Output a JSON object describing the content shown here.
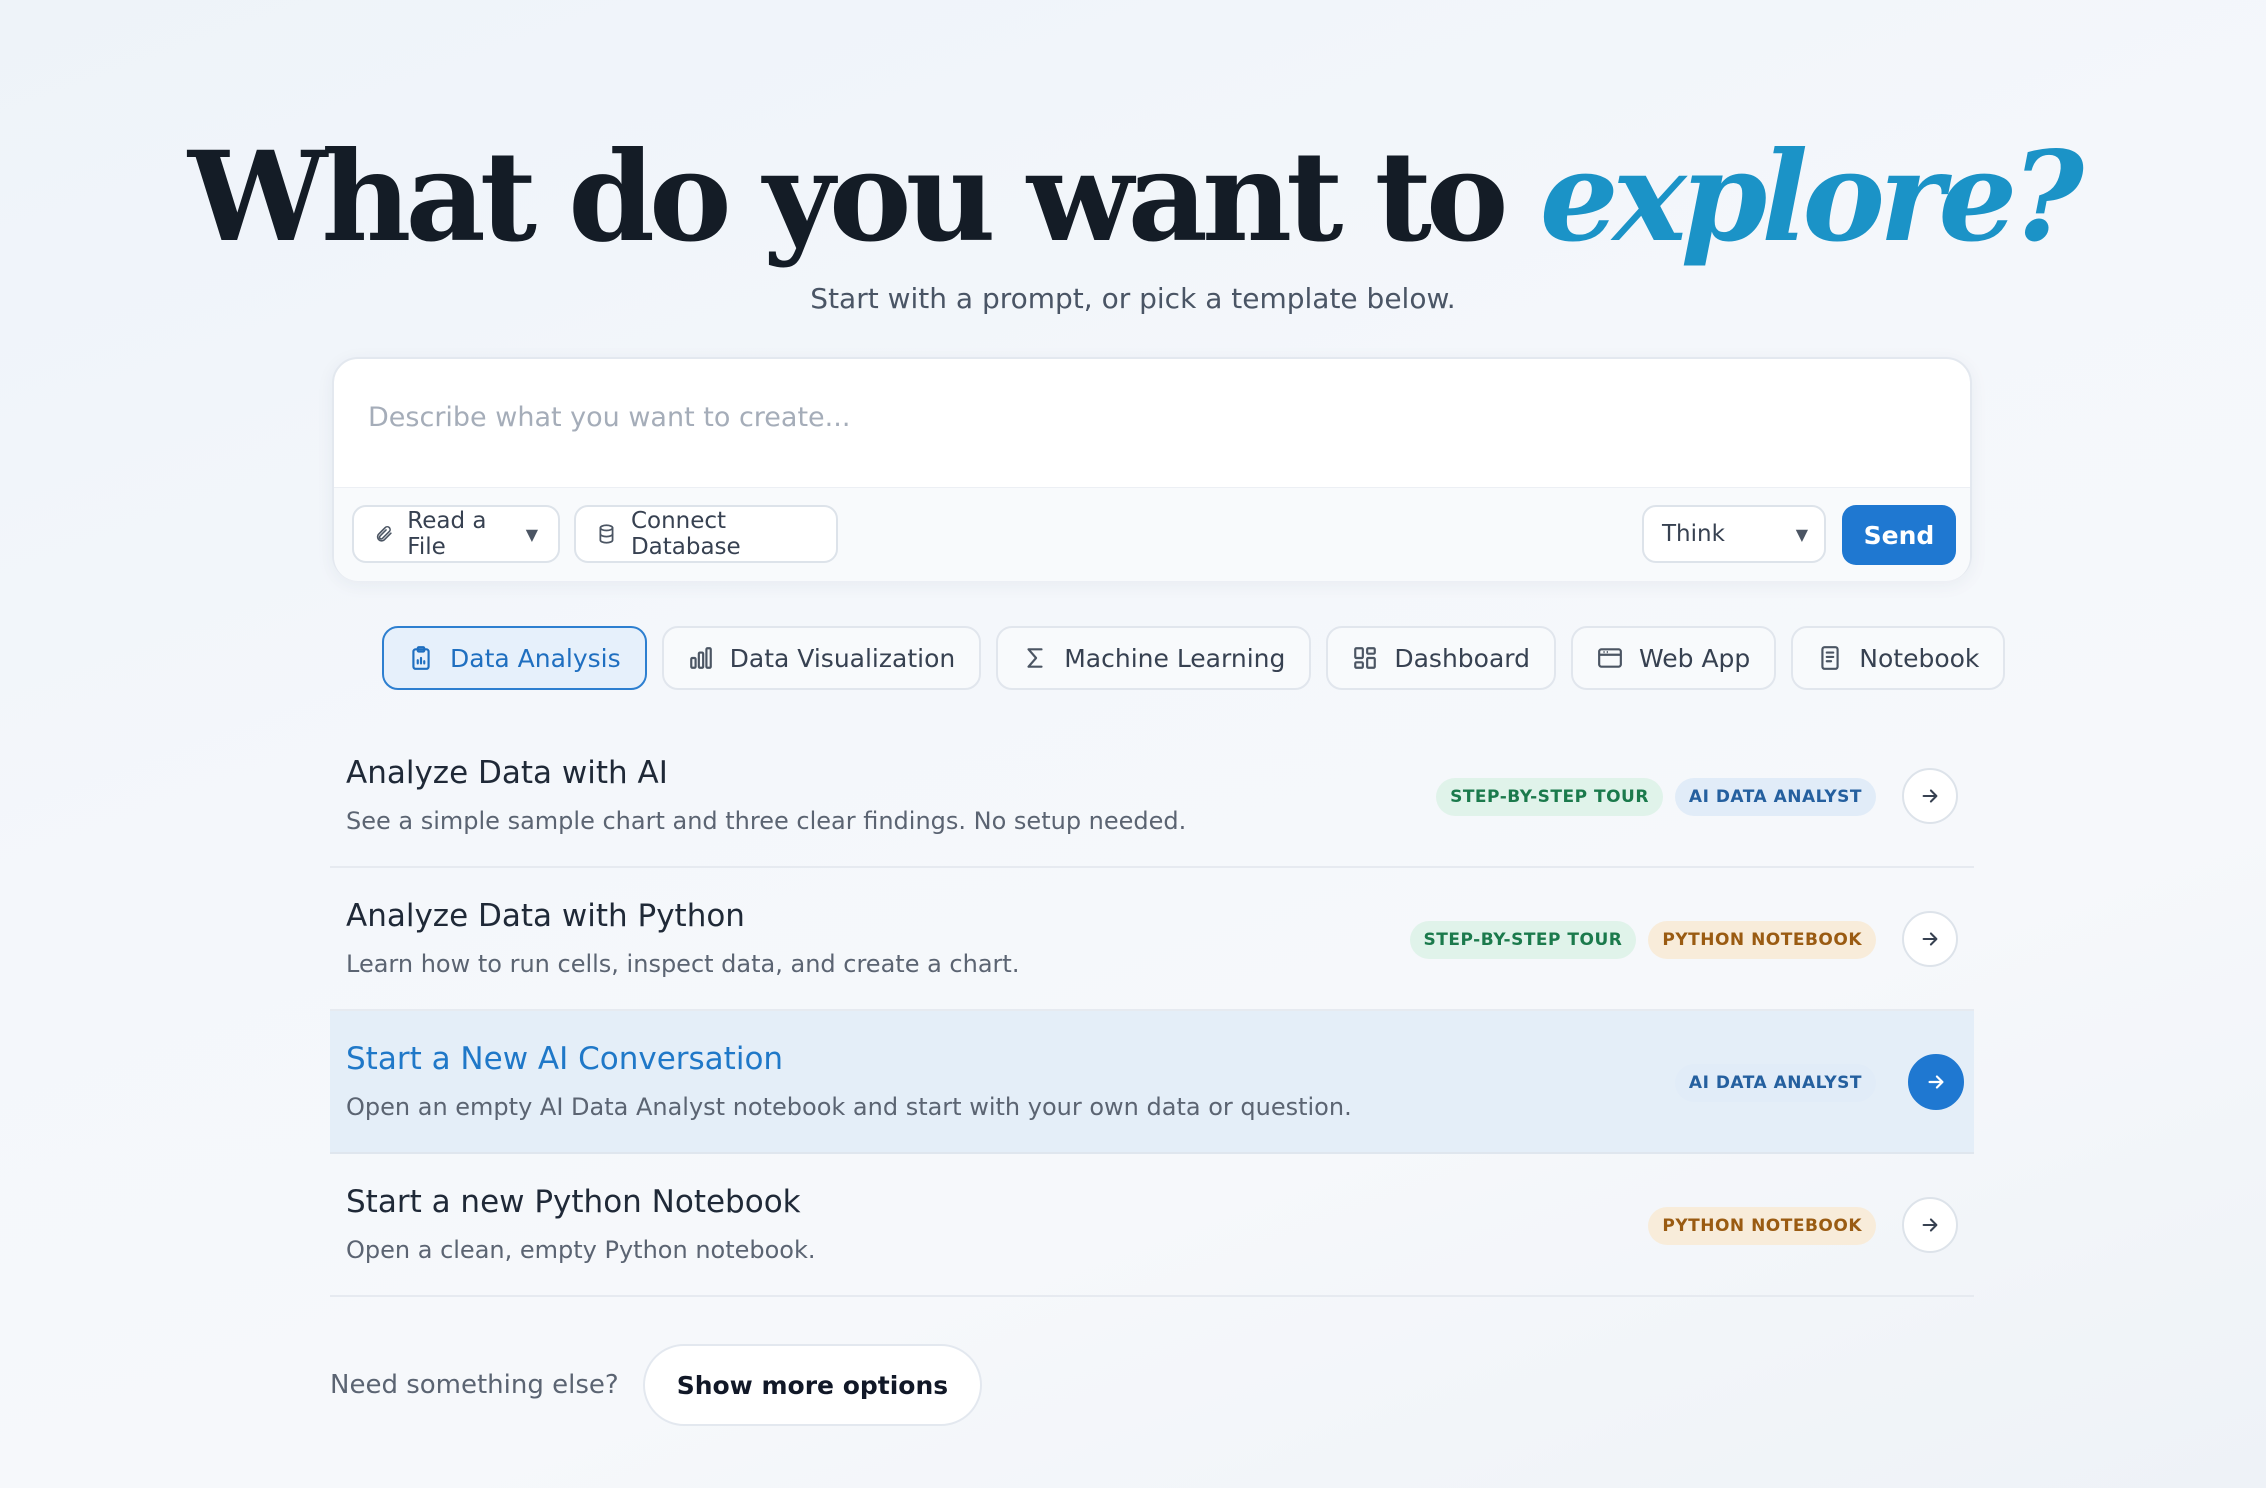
{
  "hero": {
    "title_main": "What do you want to ",
    "title_accent": "explore",
    "title_end": "?",
    "subtitle": "Start with a prompt, or pick a template below."
  },
  "prompt": {
    "placeholder": "Describe what you want to create...",
    "read_file_label": "Read a File",
    "connect_db_label": "Connect Database",
    "mode_value": "Think",
    "send_label": "Send"
  },
  "tabs": [
    {
      "label": "Data Analysis",
      "icon": "clipboard-icon",
      "active": true
    },
    {
      "label": "Data Visualization",
      "icon": "bar-chart-icon",
      "active": false
    },
    {
      "label": "Machine Learning",
      "icon": "sigma-icon",
      "active": false
    },
    {
      "label": "Dashboard",
      "icon": "dashboard-grid-icon",
      "active": false
    },
    {
      "label": "Web App",
      "icon": "browser-window-icon",
      "active": false
    },
    {
      "label": "Notebook",
      "icon": "notebook-icon",
      "active": false
    }
  ],
  "templates": [
    {
      "title": "Analyze Data with AI",
      "description": "See a simple sample chart and three clear findings. No setup needed.",
      "badges": [
        "STEP-BY-STEP TOUR",
        "AI DATA ANALYST"
      ]
    },
    {
      "title": "Analyze Data with Python",
      "description": "Learn how to run cells, inspect data, and create a chart.",
      "badges": [
        "STEP-BY-STEP TOUR",
        "PYTHON NOTEBOOK"
      ]
    },
    {
      "title": "Start a New AI Conversation",
      "description": "Open an empty AI Data Analyst notebook and start with your own data or question.",
      "badges": [
        "AI DATA ANALYST"
      ]
    },
    {
      "title": "Start a new Python Notebook",
      "description": "Open a clean, empty Python notebook.",
      "badges": [
        "PYTHON NOTEBOOK"
      ]
    }
  ],
  "footer": {
    "need_label": "Need something else?",
    "more_label": "Show more options"
  },
  "colors": {
    "accent": "#1b93c7",
    "primary": "#1f78d1"
  }
}
